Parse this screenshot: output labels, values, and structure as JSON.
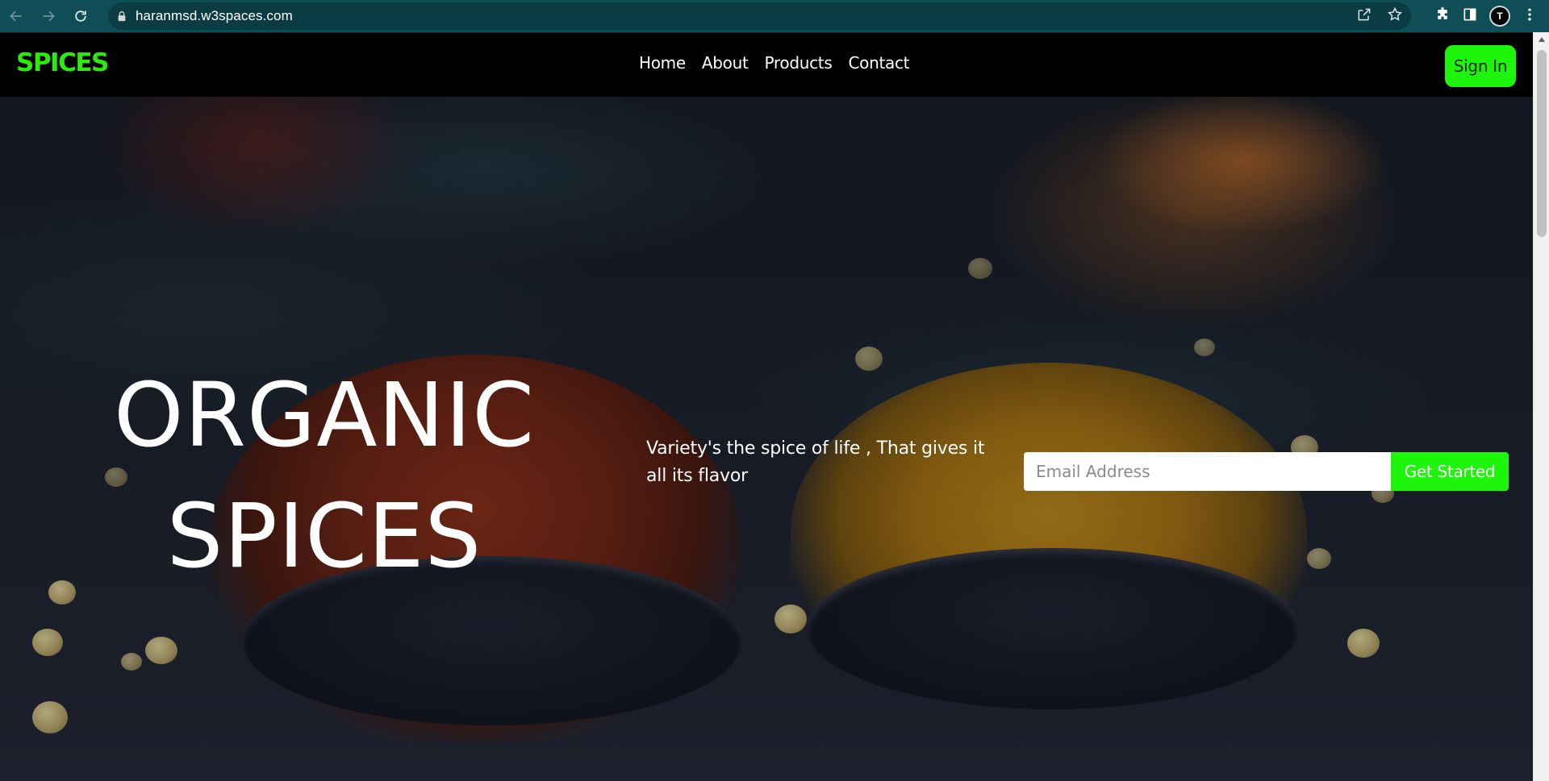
{
  "browser": {
    "url": "haranmsd.w3spaces.com",
    "profile_initial": "T",
    "icons": [
      "back-arrow-icon",
      "forward-arrow-icon",
      "reload-icon",
      "lock-icon",
      "share-icon",
      "bookmark-star-icon",
      "extensions-puzzle-icon",
      "side-panel-icon",
      "kebab-menu-icon"
    ]
  },
  "site": {
    "logo": "SPICES",
    "nav": [
      "Home",
      "About",
      "Products",
      "Contact"
    ],
    "signin_label": "Sign In"
  },
  "hero": {
    "title_line1": "ORGANIC",
    "title_line2": "SPICES",
    "tagline": "Variety's the spice of life , That gives it all its flavor",
    "email_placeholder": "Email Address",
    "cta_label": "Get Started"
  },
  "colors": {
    "brand_green": "#1df50a",
    "logo_green": "#2bea0c",
    "header_bg": "#000000",
    "browser_bar": "#0f4e57"
  }
}
